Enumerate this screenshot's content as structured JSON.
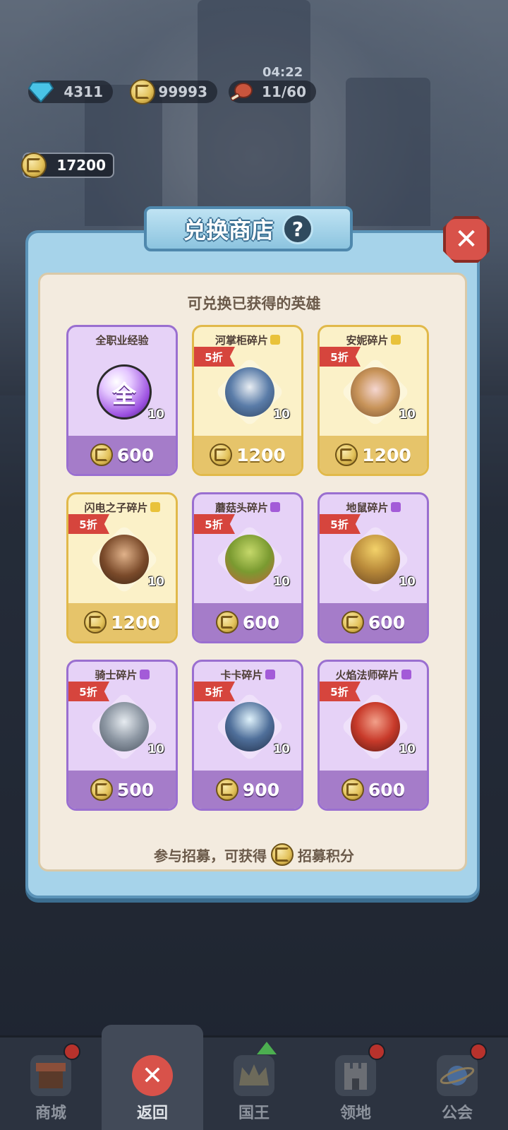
{
  "top_bar": {
    "gems": "4311",
    "gold": "99993",
    "stamina": "11/60",
    "timer": "04:22"
  },
  "points": "17200",
  "shop": {
    "title": "兑换商店",
    "help": "?",
    "close": "✕",
    "subtitle": "可兑换已获得的英雄",
    "items": [
      {
        "name": "全职业经验",
        "qty": "10",
        "price": "600",
        "discount": "",
        "ball_label": "全"
      },
      {
        "name": "河掌柜碎片",
        "qty": "10",
        "price": "1200",
        "discount": "5折"
      },
      {
        "name": "安妮碎片",
        "qty": "10",
        "price": "1200",
        "discount": "5折"
      },
      {
        "name": "闪电之子碎片",
        "qty": "10",
        "price": "1200",
        "discount": "5折"
      },
      {
        "name": "蘑菇头碎片",
        "qty": "10",
        "price": "600",
        "discount": "5折"
      },
      {
        "name": "地鼠碎片",
        "qty": "10",
        "price": "600",
        "discount": "5折"
      },
      {
        "name": "骑士碎片",
        "qty": "10",
        "price": "500",
        "discount": "5折"
      },
      {
        "name": "卡卡碎片",
        "qty": "10",
        "price": "900",
        "discount": "5折"
      },
      {
        "name": "火焰法师碎片",
        "qty": "10",
        "price": "600",
        "discount": "5折"
      }
    ],
    "footer_prefix": "参与招募，可获得",
    "footer_suffix": "招募积分"
  },
  "nav": {
    "shop": "商城",
    "back": "返回",
    "king": "国王",
    "territory": "领地",
    "guild": "公会"
  },
  "colors": {
    "card_purple": "#e6d2f7",
    "card_gold": "#fbf1c8",
    "discount_red": "#d6453d",
    "modal_blue": "#a6d3ea"
  },
  "icons": {
    "gem": "gem-icon",
    "gold": "gold-coin-icon",
    "stamina": "meat-icon",
    "points": "recruit-point-icon",
    "help": "question-icon",
    "close": "close-icon"
  }
}
